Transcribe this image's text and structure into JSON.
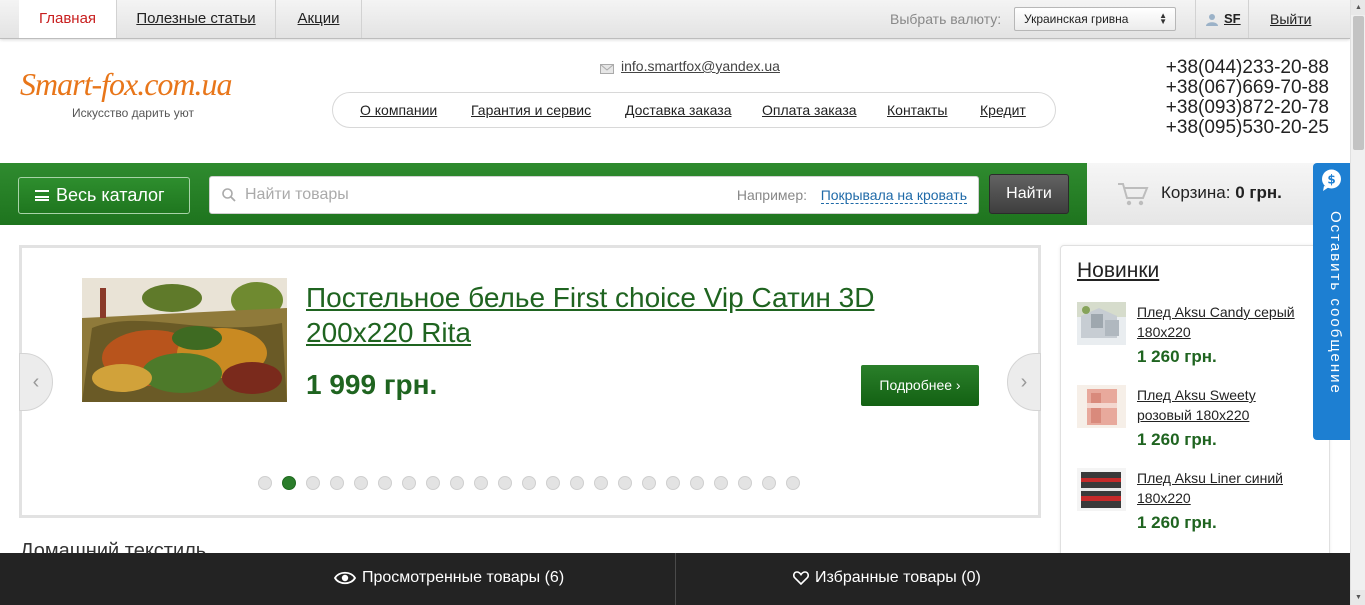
{
  "topbar": {
    "tabs": [
      {
        "label": "Главная"
      },
      {
        "label": "Полезные статьи"
      },
      {
        "label": "Акции"
      }
    ],
    "currency_label": "Выбрать валюту:",
    "currency_value": "Украинская гривна",
    "user_name": "SF",
    "logout": "Выйти"
  },
  "header": {
    "logo_text": "Smart-fox.com.ua",
    "logo_slogan": "Искусство дарить уют",
    "email": "info.smartfox@yandex.ua",
    "nav": [
      {
        "label": "О компании"
      },
      {
        "label": "Гарантия и сервис"
      },
      {
        "label": "Доставка заказа"
      },
      {
        "label": "Оплата заказа"
      },
      {
        "label": "Контакты"
      },
      {
        "label": "Кредит"
      }
    ],
    "phones": [
      "+38(044)233-20-88",
      "+38(067)669-70-88",
      "+38(093)872-20-78",
      "+38(095)530-20-25"
    ]
  },
  "searchbar": {
    "catalog_label": "Весь каталог",
    "placeholder": "Найти товары",
    "example_label": "Например:",
    "example_link": "Покрывала на кровать",
    "find_label": "Найти",
    "cart_label": "Корзина:",
    "cart_value": "0 грн."
  },
  "slider": {
    "title": "Постельное белье First choice Vip Сатин 3D 200x220 Rita",
    "price": "1 999 грн.",
    "more_label": "Подробнее ›",
    "dots_count": 23,
    "active_dot": 2
  },
  "section_title": "Домашний текстиль",
  "novinki": {
    "title": "Новинки",
    "items": [
      {
        "name": "Плед Aksu Candy серый 180x220",
        "price": "1 260 грн."
      },
      {
        "name": "Плед Aksu Sweety розовый 180x220",
        "price": "1 260 грн."
      },
      {
        "name": "Плед Aksu Liner синий 180x220",
        "price": "1 260 грн."
      }
    ]
  },
  "feedback_label": "Оставить сообщение",
  "bottombar": {
    "viewed": "Просмотренные товары (6)",
    "favorites": "Избранные товары (0)"
  },
  "colors": {
    "brand_green": "#1f6420",
    "bar_green": "#2a842a",
    "logo_orange": "#e8761a",
    "feedback_blue": "#1d7fd2",
    "active_tab_red": "#c81e1e"
  },
  "icons": [
    "user-icon",
    "mail-icon",
    "search-icon",
    "cart-icon",
    "chat-icon",
    "eye-icon",
    "heart-icon",
    "chevron-left-icon",
    "chevron-right-icon",
    "menu-icon"
  ]
}
